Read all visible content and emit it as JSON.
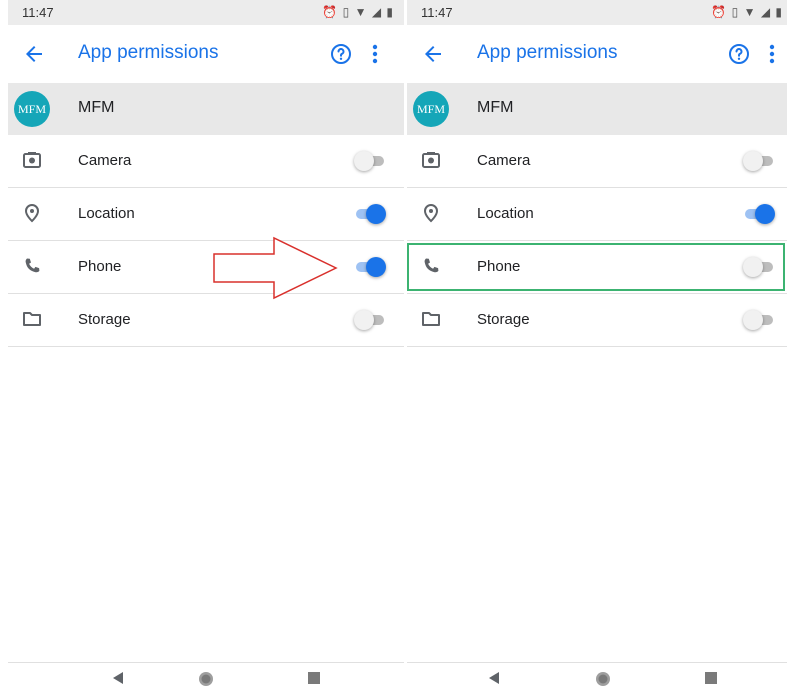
{
  "screens": [
    {
      "status_time": "11:47",
      "title": "App permissions",
      "app_name": "MFM",
      "avatar_text": "MFM",
      "permissions": [
        {
          "label": "Camera",
          "icon": "camera-icon",
          "enabled": false
        },
        {
          "label": "Location",
          "icon": "location-icon",
          "enabled": true
        },
        {
          "label": "Phone",
          "icon": "phone-icon",
          "enabled": true
        },
        {
          "label": "Storage",
          "icon": "folder-icon",
          "enabled": false
        }
      ]
    },
    {
      "status_time": "11:47",
      "title": "App permissions",
      "app_name": "MFM",
      "avatar_text": "MFM",
      "permissions": [
        {
          "label": "Camera",
          "icon": "camera-icon",
          "enabled": false
        },
        {
          "label": "Location",
          "icon": "location-icon",
          "enabled": true
        },
        {
          "label": "Phone",
          "icon": "phone-icon",
          "enabled": false
        },
        {
          "label": "Storage",
          "icon": "folder-icon",
          "enabled": false
        }
      ]
    }
  ],
  "status_icons": [
    "alarm-icon",
    "vibrate-icon",
    "wifi-icon",
    "signal-icon",
    "battery-icon"
  ],
  "nav_icons": [
    "nav-back-icon",
    "nav-home-icon",
    "nav-recents-icon"
  ],
  "colors": {
    "accent": "#1a73e8",
    "avatar": "#15a6b8",
    "header_bg": "#e8e8e8",
    "status_bg": "#ececec",
    "annotation_arrow": "#d9302c",
    "annotation_box": "#3cb371"
  },
  "annotations": {
    "arrow_points_to": "left.Phone toggle",
    "box_highlights": "right.Phone row"
  }
}
